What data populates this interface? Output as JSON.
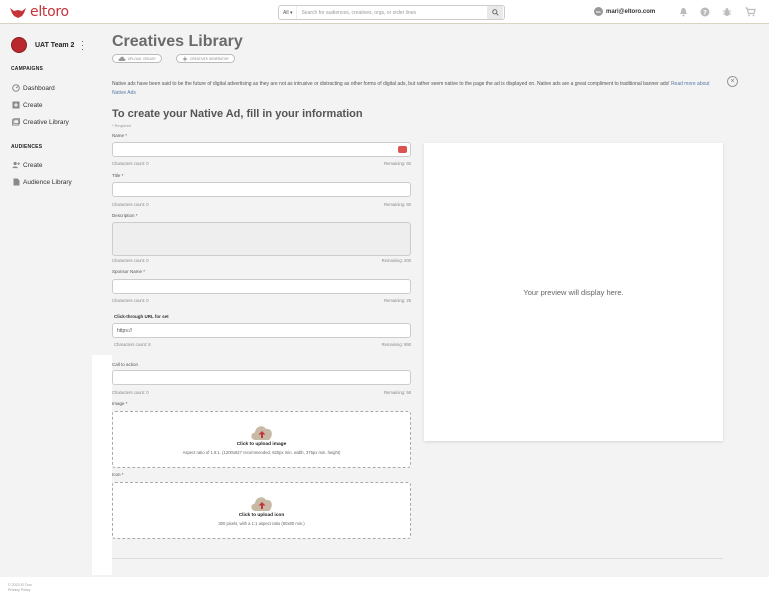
{
  "app": {
    "logo_text": "eltoro"
  },
  "search": {
    "scope": "All",
    "placeholder": "Search for audiences, creatives, orgs, or order lines"
  },
  "user": {
    "initials": "MA",
    "email": "mari@eltoro.com"
  },
  "sidebar": {
    "team": "UAT Team 2",
    "campaigns_title": "CAMPAIGNS",
    "campaigns": [
      "Dashboard",
      "Create",
      "Creative Library"
    ],
    "audiences_title": "AUDIENCES",
    "audiences": [
      "Create",
      "Audience Library"
    ]
  },
  "page": {
    "title": "Creatives Library",
    "pill_upload": "UPLOAD, CREATE",
    "pill_generator": "CREATIVES GENERATOR",
    "intro": "Native ads have been said to be the future of digital advertising as they are not as intrusive or distracting as other forms of digital ads, but rather seem native to the page the ad is displayed on. Native ads are a great compliment to traditional banner ads!",
    "intro_link": "Read more about Native Ads",
    "form_title": "To create your Native Ad, fill in your information",
    "required": "* Required"
  },
  "form": {
    "name_label": "Name *",
    "name_count": "Characters count: 0",
    "name_remaining": "Remaining: 60",
    "title_label": "Title *",
    "title_count": "Characters count: 0",
    "title_remaining": "Remaining: 60",
    "desc_label": "Description *",
    "desc_count": "Characters count: 0",
    "desc_remaining": "Remaining: 200",
    "sponsor_label": "Sponsor Name *",
    "sponsor_count": "Characters count: 0",
    "sponsor_remaining": "Remaining: 25",
    "url_label": "Click-through URL for set",
    "url_value": "https://",
    "url_count": "Characters count: 8",
    "url_remaining": "Remaining: 990",
    "cta_label": "Call to action",
    "cta_count": "Characters count: 0",
    "cta_remaining": "Remaining: 58",
    "image_label": "Image *",
    "image_upload": "Click to upload image",
    "image_hint": "Aspect ratio of 1.9:1. (1200x627 recommended, 620px min. width, 375px min. height)",
    "icon_label": "Icon *",
    "icon_upload": "Click to upload icon",
    "icon_hint": "300 pixels, with a 1:1 aspect ratio (80x80 min.)"
  },
  "preview": {
    "text": "Your preview will display here."
  },
  "footer": {
    "copyright": "© 2023 El Toro",
    "privacy": "Privacy Policy"
  },
  "colors": {
    "brand": "#c4343a",
    "link": "#5a7aa6",
    "upload_accent": "#c4343a"
  }
}
